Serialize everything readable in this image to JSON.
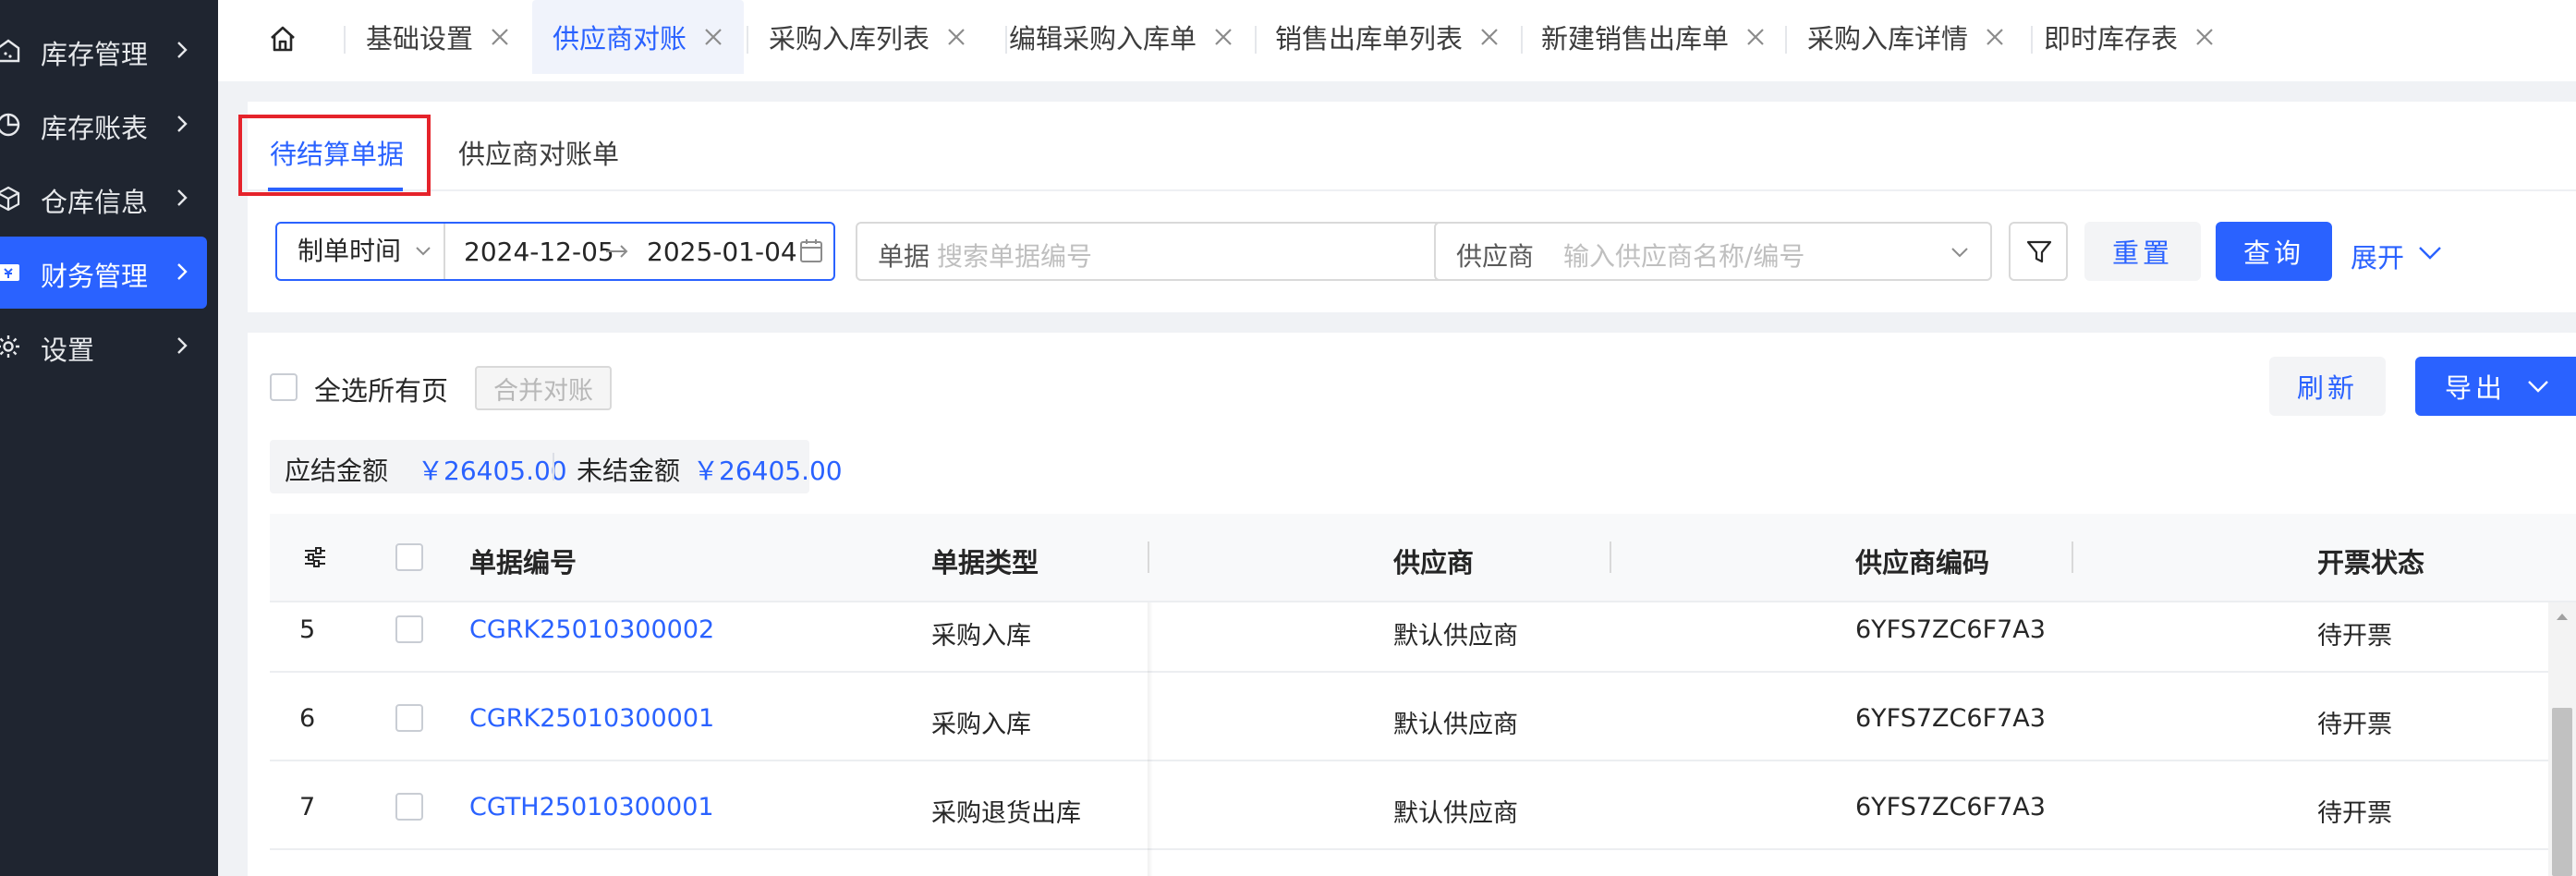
{
  "sidebar": {
    "items": [
      {
        "label": "库存管理",
        "icon": "inventory-icon",
        "active": false
      },
      {
        "label": "库存账表",
        "icon": "pie-chart-icon",
        "active": false
      },
      {
        "label": "仓库信息",
        "icon": "warehouse-cube-icon",
        "active": false
      },
      {
        "label": "财务管理",
        "icon": "finance-wallet-icon",
        "active": true
      },
      {
        "label": "设置",
        "icon": "gear-icon",
        "active": false
      }
    ]
  },
  "tabs": [
    {
      "label": "基础设置",
      "active": false
    },
    {
      "label": "供应商对账",
      "active": true
    },
    {
      "label": "采购入库列表",
      "active": false
    },
    {
      "label": "编辑采购入库单",
      "active": false
    },
    {
      "label": "销售出库单列表",
      "active": false
    },
    {
      "label": "新建销售出库单",
      "active": false
    },
    {
      "label": "采购入库详情",
      "active": false
    },
    {
      "label": "即时库存表",
      "active": false
    }
  ],
  "subtabs": {
    "pending": "待结算单据",
    "statements": "供应商对账单"
  },
  "filters": {
    "date_type": "制单时间",
    "date_start": "2024-12-05",
    "date_end": "2025-01-04",
    "doc_label": "单据",
    "doc_placeholder": "搜索单据编号",
    "supplier_label": "供应商",
    "supplier_placeholder": "输入供应商名称/编号",
    "reset_label": "重置",
    "query_label": "查询",
    "expand_label": "展开"
  },
  "toolbar": {
    "select_all_label": "全选所有页",
    "merge_label": "合并对账",
    "refresh_label": "刷新",
    "export_label": "导出"
  },
  "summary": {
    "payable_label": "应结金额",
    "payable_value": "￥26405.00",
    "unsettled_label": "未结金额",
    "unsettled_value": "￥26405.00"
  },
  "table": {
    "headers": [
      "单据编号",
      "单据类型",
      "供应商",
      "供应商编码",
      "开票状态"
    ],
    "rows": [
      {
        "idx": "5",
        "doc_no": "CGRK25010300002",
        "doc_type": "采购入库",
        "supplier": "默认供应商",
        "supplier_code": "6YFS7ZC6F7A3",
        "invoice_status": "待开票"
      },
      {
        "idx": "6",
        "doc_no": "CGRK25010300001",
        "doc_type": "采购入库",
        "supplier": "默认供应商",
        "supplier_code": "6YFS7ZC6F7A3",
        "invoice_status": "待开票"
      },
      {
        "idx": "7",
        "doc_no": "CGTH25010300001",
        "doc_type": "采购退货出库",
        "supplier": "默认供应商",
        "supplier_code": "6YFS7ZC6F7A3",
        "invoice_status": "待开票"
      }
    ]
  },
  "colors": {
    "accent": "#2a62ff",
    "sidebar_bg": "#1f2530",
    "highlight": "#e5232b"
  }
}
